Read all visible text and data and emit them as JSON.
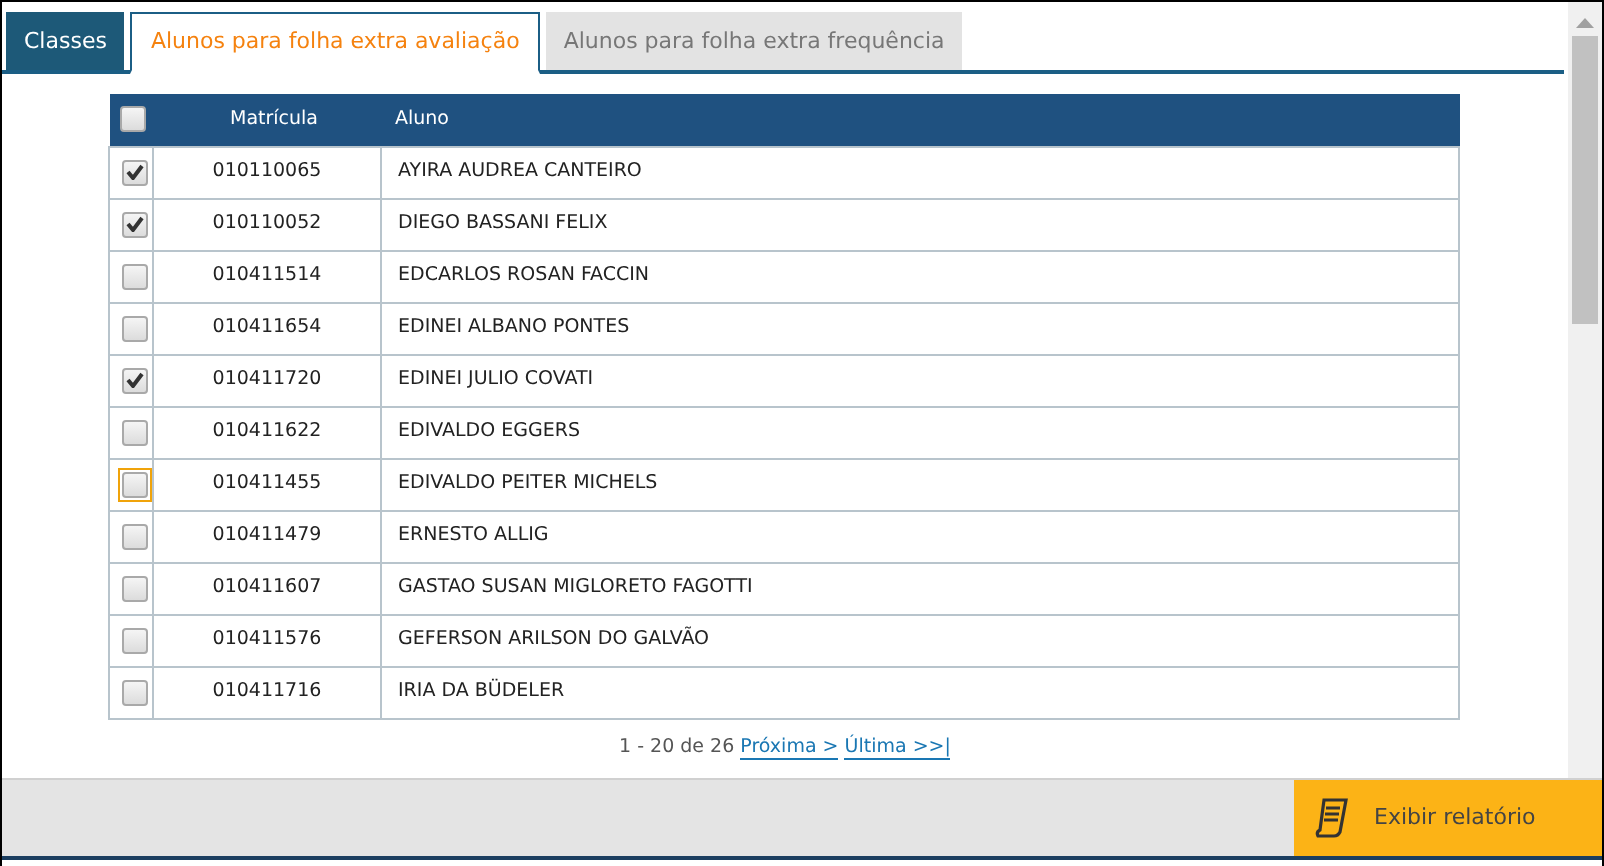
{
  "tabs": [
    {
      "label": "Classes",
      "kind": "section",
      "selected": false
    },
    {
      "label": "Alunos para folha extra avaliação",
      "kind": "page",
      "selected": true
    },
    {
      "label": "Alunos para folha extra frequência",
      "kind": "page",
      "selected": false
    }
  ],
  "table": {
    "select_all": {
      "checked": false
    },
    "columns": [
      "Matrícula",
      "Aluno"
    ],
    "rows": [
      {
        "checked": true,
        "focused": false,
        "matricula": "010110065",
        "aluno": "AYIRA AUDREA CANTEIRO"
      },
      {
        "checked": true,
        "focused": false,
        "matricula": "010110052",
        "aluno": "DIEGO BASSANI FELIX"
      },
      {
        "checked": false,
        "focused": false,
        "matricula": "010411514",
        "aluno": "EDCARLOS ROSAN FACCIN"
      },
      {
        "checked": false,
        "focused": false,
        "matricula": "010411654",
        "aluno": "EDINEI ALBANO PONTES"
      },
      {
        "checked": true,
        "focused": false,
        "matricula": "010411720",
        "aluno": "EDINEI JULIO COVATI"
      },
      {
        "checked": false,
        "focused": false,
        "matricula": "010411622",
        "aluno": "EDIVALDO EGGERS"
      },
      {
        "checked": false,
        "focused": true,
        "matricula": "010411455",
        "aluno": "EDIVALDO PEITER MICHELS"
      },
      {
        "checked": false,
        "focused": false,
        "matricula": "010411479",
        "aluno": "ERNESTO ALLIG"
      },
      {
        "checked": false,
        "focused": false,
        "matricula": "010411607",
        "aluno": "GASTAO SUSAN MIGLORETO FAGOTTI"
      },
      {
        "checked": false,
        "focused": false,
        "matricula": "010411576",
        "aluno": "GEFERSON ARILSON DO GALVÃO"
      },
      {
        "checked": false,
        "focused": false,
        "matricula": "010411716",
        "aluno": "IRIA DA BÜDELER"
      }
    ]
  },
  "pagination": {
    "summary": "1 - 20 de 26",
    "links": [
      "Próxima >",
      "Última >>|"
    ]
  },
  "footer": {
    "button": "Exibir relatório"
  }
}
